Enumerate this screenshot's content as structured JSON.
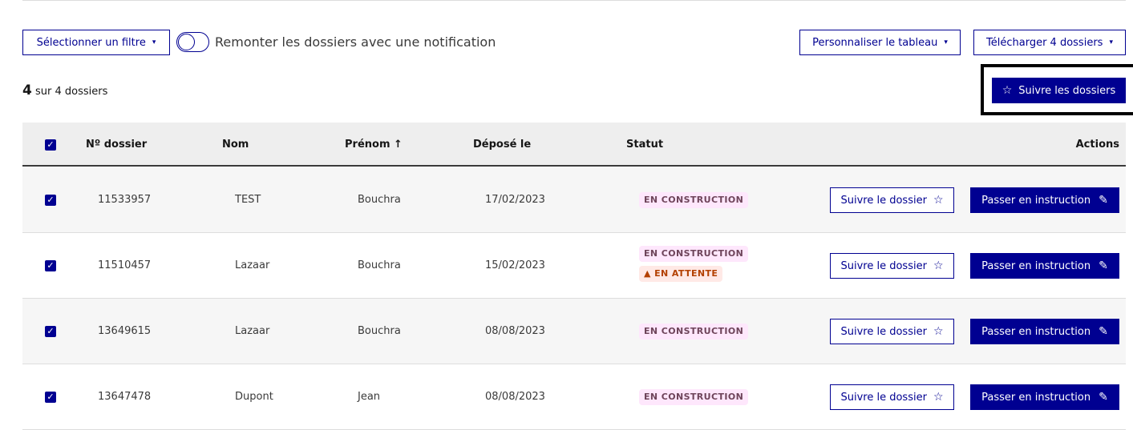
{
  "toolbar": {
    "filter_button": "Sélectionner un filtre",
    "toggle_label": "Remonter les dossiers avec une notification",
    "customize_button": "Personnaliser le tableau",
    "download_button": "Télécharger 4 dossiers",
    "follow_all_button": "Suivre les dossiers"
  },
  "summary": {
    "count": "4",
    "suffix": "sur 4 dossiers"
  },
  "table": {
    "headers": {
      "number": "Nº dossier",
      "nom": "Nom",
      "prenom": "Prénom ↑",
      "depose": "Déposé le",
      "statut": "Statut",
      "actions": "Actions"
    },
    "rows": [
      {
        "number": "11533957",
        "nom": "TEST",
        "prenom": "Bouchra",
        "date": "17/02/2023",
        "status": "EN CONSTRUCTION"
      },
      {
        "number": "11510457",
        "nom": "Lazaar",
        "prenom": "Bouchra",
        "date": "15/02/2023",
        "status": "EN CONSTRUCTION",
        "status2": "EN ATTENTE"
      },
      {
        "number": "13649615",
        "nom": "Lazaar",
        "prenom": "Bouchra",
        "date": "08/08/2023",
        "status": "EN CONSTRUCTION"
      },
      {
        "number": "13647478",
        "nom": "Dupont",
        "prenom": "Jean",
        "date": "08/08/2023",
        "status": "EN CONSTRUCTION"
      }
    ],
    "follow_label": "Suivre le dossier",
    "instruction_label": "Passer en instruction"
  },
  "icons": {
    "caret": "▾",
    "star": "☆",
    "pencil": "✎",
    "warning": "▲",
    "check": "✓"
  },
  "colors": {
    "primary": "#000091",
    "badge_construction_bg": "#fee7fc",
    "badge_construction_text": "#6e445a",
    "badge_waiting_bg": "#ffe9e6",
    "badge_waiting_text": "#b34000"
  }
}
